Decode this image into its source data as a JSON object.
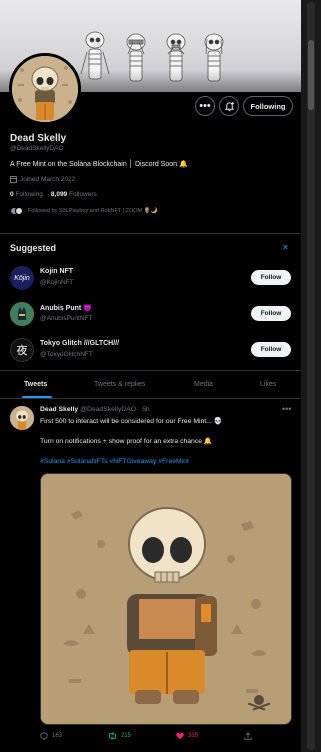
{
  "profile": {
    "name": "Dead Skelly",
    "handle": "@DeadSkellyDAO",
    "bio": "A Free Mint on the Solana Blockchain │ Discord Soon",
    "bio_emoji": "🔔",
    "joined": "Joined March 2022",
    "following_count": "0",
    "following_label": "Following",
    "followers_count": "8,099",
    "followers_label": "Followers",
    "followed_by": "Followed by S0LPlayboy and RobNFT | ZOOM 🌷🌙"
  },
  "actions": {
    "more_icon": "more-icon",
    "notify_icon": "bell-plus-icon",
    "following_button": "Following"
  },
  "suggested": {
    "title": "Suggested",
    "close_icon": "close-icon",
    "follow_label": "Follow",
    "items": [
      {
        "name": "Kojin NFT",
        "handle": "@KojinNFT",
        "avatar_text": "Kōjin"
      },
      {
        "name": "Anubis Punt 👿",
        "handle": "@AnubisPuntNFT",
        "avatar_text": ""
      },
      {
        "name": "Tokyo Glitch ///GLTCH///",
        "handle": "@TokyoGlitchNFT",
        "avatar_text": "夜"
      }
    ]
  },
  "tabs": [
    "Tweets",
    "Tweets & replies",
    "Media",
    "Likes"
  ],
  "tweet": {
    "name": "Dead Skelly",
    "meta": "@DeadSkellyDAO · 5h",
    "line1": "First 500 to interact will be considered for our Free Mint... 💀",
    "line2": "Turn on notifications + show proof for an extra chance 🔔",
    "hashtags": "#Solana #SolanaNFTs #NFTGiveaway #FreeMint",
    "replies": "163",
    "retweets": "215",
    "likes": "335"
  },
  "colors": {
    "accent": "#1d9bf0",
    "retweet": "#00ba7c",
    "like": "#f91880",
    "muted": "#71767b"
  }
}
